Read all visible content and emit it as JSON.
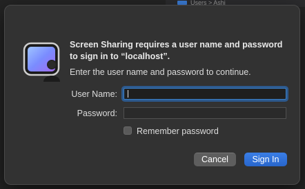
{
  "background": {
    "crumbs_text": "Users > Ashi"
  },
  "dialog": {
    "message": "Screen Sharing requires a user name and password to sign in to “localhost”.",
    "submessage": "Enter the user name and password to continue.",
    "icon": "screen-sharing-icon",
    "fields": {
      "username_label": "User Name:",
      "username_value": "",
      "password_label": "Password:",
      "password_value": ""
    },
    "remember_label": "Remember password",
    "remember_checked": false,
    "buttons": {
      "cancel": "Cancel",
      "signin": "Sign In"
    },
    "colors": {
      "accent": "#2d6fd6",
      "focus_ring": "#3a80c9",
      "sheet_bg": "#323232"
    }
  }
}
